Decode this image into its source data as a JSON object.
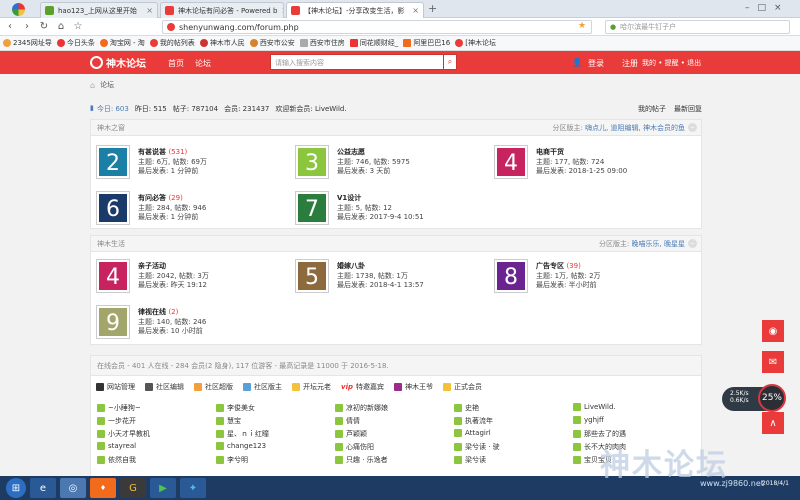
{
  "browser": {
    "tabs": [
      {
        "title": "hao123_上网从这里开始",
        "color": "#5aa02c"
      },
      {
        "title": "神木论坛有问必答 - Powered b",
        "color": "#e93b39"
      },
      {
        "title": "【神木论坛】-分享改变生活，影",
        "color": "#e93b39"
      }
    ],
    "new_tab": "+",
    "url": "shenyunwang.com/forum.php",
    "search_placeholder": "哈尔滨最牛钉子户",
    "bookmarks": [
      "2345网址导",
      "今日头条",
      "淘宝网 - 淘",
      "我的帖列表",
      "神木市人民",
      "西安市公安",
      "西安市住房",
      "同花顺财经_",
      "阿里巴巴16",
      "[神木论坛"
    ]
  },
  "site": {
    "logo": "神木论坛",
    "nav": [
      "首页",
      "论坛"
    ],
    "search_placeholder": "请输入搜索内容",
    "login": "登录",
    "register": "注册",
    "user_links": "我的 • 提醒 • 退出",
    "breadcrumb": "论坛"
  },
  "stats": {
    "today": "今日: 603",
    "yesterday": "昨日: 515",
    "posts": "帖子: 787104",
    "members": "会员: 231437",
    "welcome": "欢迎新会员: LiveWild.",
    "my_posts": "我的帖子",
    "latest": "最新回复"
  },
  "sections": [
    {
      "name": "神木之窗",
      "mods_label": "分区版主:",
      "mods": "嗨点儿, 道阻编辑, 神木会员的鱼",
      "forums": [
        {
          "num": "2",
          "color": "#1b7fa6",
          "name": "有甚说甚",
          "today": "(531)",
          "line1": "主题: 6万, 帖数: 69万",
          "line2": "最后发表: 1 分钟前"
        },
        {
          "num": "3",
          "color": "#8cc63e",
          "name": "公益志愿",
          "today": "",
          "line1": "主题: 746, 帖数: 5975",
          "line2": "最后发表: 3 天前"
        },
        {
          "num": "4",
          "color": "#c7245f",
          "name": "电商干货",
          "today": "",
          "line1": "主题: 177, 帖数: 724",
          "line2": "最后发表: 2018-1-25 09:00"
        },
        {
          "num": "6",
          "color": "#1a3b6a",
          "name": "有问必答",
          "today": "(29)",
          "line1": "主题: 284, 帖数: 946",
          "line2": "最后发表: 1 分钟前"
        },
        {
          "num": "7",
          "color": "#2a7d3d",
          "name": "V1设计",
          "today": "",
          "line1": "主题: 5, 帖数: 12",
          "line2": "最后发表: 2017-9-4 10:51"
        }
      ]
    },
    {
      "name": "神木生活",
      "mods_label": "分区版主:",
      "mods": "晚喵乐乐, 晚星星",
      "forums": [
        {
          "num": "4",
          "color": "#c7245f",
          "name": "亲子活动",
          "today": "",
          "line1": "主题: 2042, 帖数: 3万",
          "line2": "最后发表: 昨天 19:12"
        },
        {
          "num": "5",
          "color": "#8c6a3e",
          "name": "婚嫁八卦",
          "today": "",
          "line1": "主题: 1738, 帖数: 1万",
          "line2": "最后发表: 2018-4-1 13:57"
        },
        {
          "num": "8",
          "color": "#6b2391",
          "name": "广告专区",
          "today": "(39)",
          "line1": "主题: 1万, 帖数: 2万",
          "line2": "最后发表: 半小时前"
        },
        {
          "num": "9",
          "color": "#a3a66b",
          "name": "律视在线",
          "today": "(2)",
          "line1": "主题: 140, 帖数: 246",
          "line2": "最后发表: 10 小时前"
        }
      ]
    }
  ],
  "online": {
    "header": "在线会员 - 401 人在线 - 284 会员(2 隐身), 117 位游客 - 最高记录是 11000 于 2016-5-18.",
    "legend": [
      {
        "label": "网站管理",
        "color": "#333"
      },
      {
        "label": "社区编辑",
        "color": "#555"
      },
      {
        "label": "社区超版",
        "color": "#f2a03d"
      },
      {
        "label": "社区版主",
        "color": "#5a9fd6"
      },
      {
        "label": "开坛元老",
        "color": "#f2c23d"
      },
      {
        "label": "特邀嘉宾",
        "color": "#e33"
      },
      {
        "label": "神木王爷",
        "color": "#9b2c8c"
      },
      {
        "label": "正式会员",
        "color": "#f2c23d"
      }
    ],
    "vip": "vip",
    "members": [
      [
        "~小睡狗~",
        "李俊美女",
        "凉初的新娜娘",
        "史艳",
        "LiveWild."
      ],
      [
        "一步花开",
        "慧宝",
        "倩倩",
        "执著流年",
        "yghjff"
      ],
      [
        "小天才早教机",
        "星、ｎｉ红瞳",
        "芦颖颖",
        "Attagirl",
        "那些去了的遇"
      ],
      [
        "stayreal",
        "change123",
        "心痛伤阳",
        "梁兮读 · 驶",
        "长不大的肉肉"
      ],
      [
        "依然自我",
        "李兮明",
        "只趣 · 乐逸者",
        "梁兮读",
        "宝贝宝贝"
      ]
    ]
  },
  "float": {
    "speed_up": "2.5K/s",
    "speed_down": "0.6K/s",
    "percent": "25%"
  },
  "taskbar": {
    "watermark": "神木论坛",
    "url": "www.zj9860.net",
    "time": "2018/4/1"
  }
}
